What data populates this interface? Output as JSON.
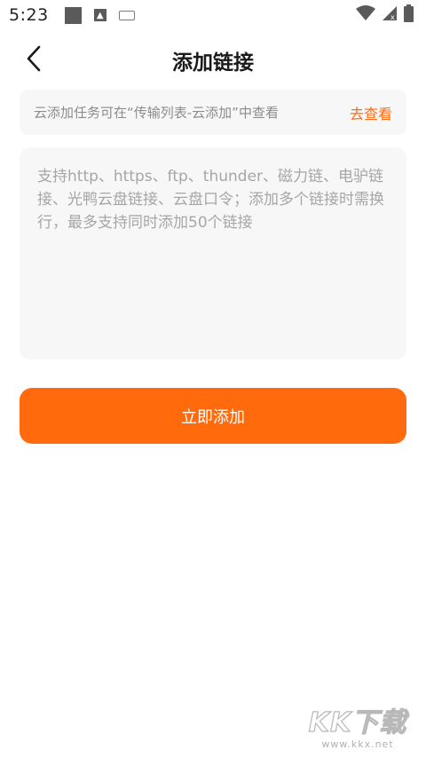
{
  "status_bar": {
    "time": "5:23",
    "icons": [
      "notification-square-icon",
      "app-a-icon",
      "keyboard-icon",
      "wifi-icon",
      "signal-icon",
      "battery-icon"
    ]
  },
  "header": {
    "back_icon": "chevron-left-icon",
    "title": "添加链接"
  },
  "notice": {
    "text": "云添加任务可在“传输列表-云添加”中查看",
    "link_label": "去查看"
  },
  "link_input": {
    "placeholder": "支持http、https、ftp、thunder、磁力链、电驴链接、光鸭云盘链接、云盘口令；添加多个链接时需换行，最多支持同时添加50个链接",
    "value": ""
  },
  "submit_button": {
    "label": "立即添加"
  },
  "watermark": {
    "main": "KK下载",
    "sub": "www.kkx.net"
  },
  "colors": {
    "accent": "#ff6a0c",
    "link": "#ff6a13",
    "panel_bg": "#f7f7f7",
    "placeholder": "#a6a6a6"
  }
}
